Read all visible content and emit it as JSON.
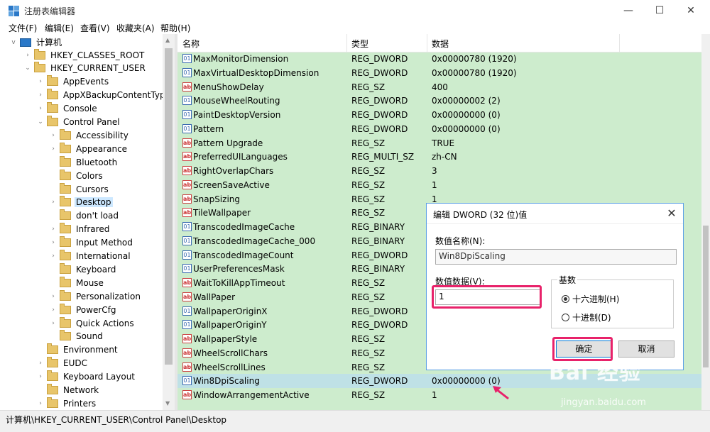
{
  "window": {
    "title": "注册表编辑器",
    "minimize": "—",
    "maximize": "☐",
    "close": "✕"
  },
  "menu": [
    "文件(F)",
    "编辑(E)",
    "查看(V)",
    "收藏夹(A)",
    "帮助(H)"
  ],
  "tree": {
    "root": "计算机",
    "items": [
      {
        "label": "HKEY_CLASSES_ROOT",
        "level": 1,
        "expander": ">"
      },
      {
        "label": "HKEY_CURRENT_USER",
        "level": 1,
        "expander": "v"
      },
      {
        "label": "AppEvents",
        "level": 2,
        "expander": ">"
      },
      {
        "label": "AppXBackupContentType",
        "level": 2,
        "expander": ">"
      },
      {
        "label": "Console",
        "level": 2,
        "expander": ">"
      },
      {
        "label": "Control Panel",
        "level": 2,
        "expander": "v"
      },
      {
        "label": "Accessibility",
        "level": 3,
        "expander": ">"
      },
      {
        "label": "Appearance",
        "level": 3,
        "expander": ">"
      },
      {
        "label": "Bluetooth",
        "level": 3,
        "expander": ""
      },
      {
        "label": "Colors",
        "level": 3,
        "expander": ""
      },
      {
        "label": "Cursors",
        "level": 3,
        "expander": ""
      },
      {
        "label": "Desktop",
        "level": 3,
        "expander": ">",
        "selected": true
      },
      {
        "label": "don't load",
        "level": 3,
        "expander": ""
      },
      {
        "label": "Infrared",
        "level": 3,
        "expander": ">"
      },
      {
        "label": "Input Method",
        "level": 3,
        "expander": ">"
      },
      {
        "label": "International",
        "level": 3,
        "expander": ">"
      },
      {
        "label": "Keyboard",
        "level": 3,
        "expander": ""
      },
      {
        "label": "Mouse",
        "level": 3,
        "expander": ""
      },
      {
        "label": "Personalization",
        "level": 3,
        "expander": ">"
      },
      {
        "label": "PowerCfg",
        "level": 3,
        "expander": ">"
      },
      {
        "label": "Quick Actions",
        "level": 3,
        "expander": ">"
      },
      {
        "label": "Sound",
        "level": 3,
        "expander": ""
      },
      {
        "label": "Environment",
        "level": 2,
        "expander": ""
      },
      {
        "label": "EUDC",
        "level": 2,
        "expander": ">"
      },
      {
        "label": "Keyboard Layout",
        "level": 2,
        "expander": ">"
      },
      {
        "label": "Network",
        "level": 2,
        "expander": ""
      },
      {
        "label": "Printers",
        "level": 2,
        "expander": ">"
      }
    ]
  },
  "columns": {
    "name": "名称",
    "type": "类型",
    "data": "数据"
  },
  "rows": [
    {
      "icon": "binary",
      "name": "MaxMonitorDimension",
      "type": "REG_DWORD",
      "data": "0x00000780 (1920)"
    },
    {
      "icon": "binary",
      "name": "MaxVirtualDesktopDimension",
      "type": "REG_DWORD",
      "data": "0x00000780 (1920)"
    },
    {
      "icon": "string",
      "name": "MenuShowDelay",
      "type": "REG_SZ",
      "data": "400"
    },
    {
      "icon": "binary",
      "name": "MouseWheelRouting",
      "type": "REG_DWORD",
      "data": "0x00000002 (2)"
    },
    {
      "icon": "binary",
      "name": "PaintDesktopVersion",
      "type": "REG_DWORD",
      "data": "0x00000000 (0)"
    },
    {
      "icon": "binary",
      "name": "Pattern",
      "type": "REG_DWORD",
      "data": "0x00000000 (0)"
    },
    {
      "icon": "string",
      "name": "Pattern Upgrade",
      "type": "REG_SZ",
      "data": "TRUE"
    },
    {
      "icon": "string",
      "name": "PreferredUILanguages",
      "type": "REG_MULTI_SZ",
      "data": "zh-CN"
    },
    {
      "icon": "string",
      "name": "RightOverlapChars",
      "type": "REG_SZ",
      "data": "3"
    },
    {
      "icon": "string",
      "name": "ScreenSaveActive",
      "type": "REG_SZ",
      "data": "1"
    },
    {
      "icon": "string",
      "name": "SnapSizing",
      "type": "REG_SZ",
      "data": "1"
    },
    {
      "icon": "string",
      "name": "TileWallpaper",
      "type": "REG_SZ",
      "data": ""
    },
    {
      "icon": "binary",
      "name": "TranscodedImageCache",
      "type": "REG_BINARY",
      "data": ""
    },
    {
      "icon": "binary",
      "name": "TranscodedImageCache_000",
      "type": "REG_BINARY",
      "data": ""
    },
    {
      "icon": "binary",
      "name": "TranscodedImageCount",
      "type": "REG_DWORD",
      "data": ""
    },
    {
      "icon": "binary",
      "name": "UserPreferencesMask",
      "type": "REG_BINARY",
      "data": ""
    },
    {
      "icon": "string",
      "name": "WaitToKillAppTimeout",
      "type": "REG_SZ",
      "data": ""
    },
    {
      "icon": "string",
      "name": "WallPaper",
      "type": "REG_SZ",
      "data": ""
    },
    {
      "icon": "binary",
      "name": "WallpaperOriginX",
      "type": "REG_DWORD",
      "data": ""
    },
    {
      "icon": "binary",
      "name": "WallpaperOriginY",
      "type": "REG_DWORD",
      "data": ""
    },
    {
      "icon": "string",
      "name": "WallpaperStyle",
      "type": "REG_SZ",
      "data": ""
    },
    {
      "icon": "string",
      "name": "WheelScrollChars",
      "type": "REG_SZ",
      "data": ""
    },
    {
      "icon": "string",
      "name": "WheelScrollLines",
      "type": "REG_SZ",
      "data": ""
    },
    {
      "icon": "binary",
      "name": "Win8DpiScaling",
      "type": "REG_DWORD",
      "data": "0x00000000 (0)",
      "selected": true
    },
    {
      "icon": "string",
      "name": "WindowArrangementActive",
      "type": "REG_SZ",
      "data": "1"
    }
  ],
  "status": "计算机\\HKEY_CURRENT_USER\\Control Panel\\Desktop",
  "dialog": {
    "title": "编辑 DWORD (32 位)值",
    "name_label": "数值名称(N):",
    "name_value": "Win8DpiScaling",
    "data_label": "数值数据(V):",
    "data_value": "1",
    "base_label": "基数",
    "hex_label": "十六进制(H)",
    "dec_label": "十进制(D)",
    "base_selected": "hex",
    "ok": "确定",
    "cancel": "取消"
  },
  "watermark": {
    "brand": "Bai  经验",
    "url": "jingyan.baidu.com"
  },
  "colors": {
    "list_bg": "#cdeccd",
    "selected_row": "#bfe1e6",
    "highlight": "#e8226a",
    "accent": "#0078d7"
  },
  "icons": {
    "app": "registry-editor-icon",
    "string": "ab-string-icon",
    "binary": "binary-value-icon",
    "folder": "folder-icon",
    "computer": "computer-icon"
  }
}
